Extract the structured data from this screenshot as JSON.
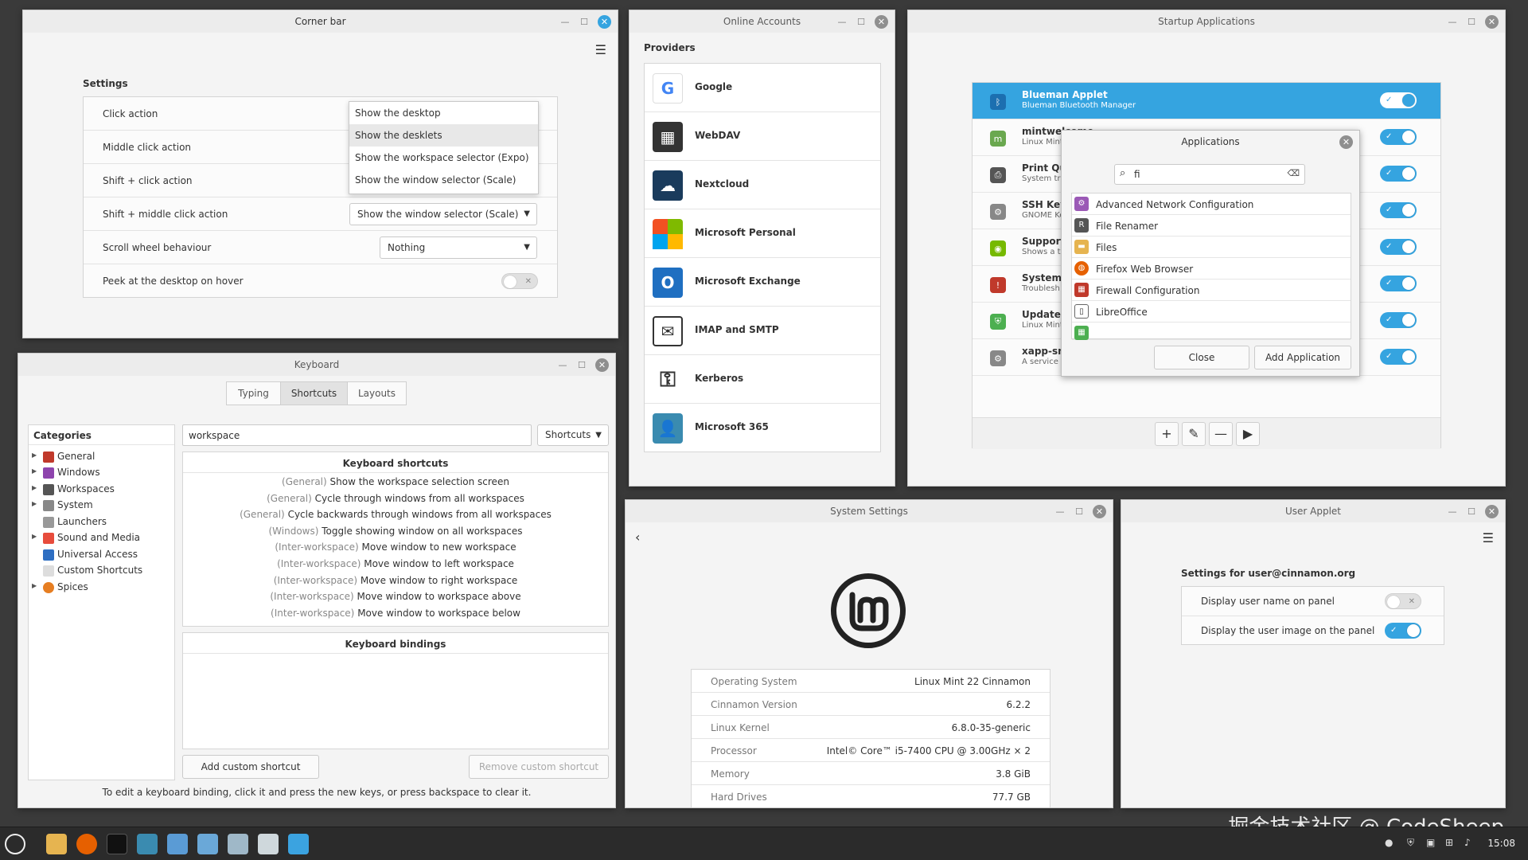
{
  "corner_bar": {
    "title": "Corner bar",
    "settings_heading": "Settings",
    "rows": [
      {
        "label": "Click action"
      },
      {
        "label": "Middle click action"
      },
      {
        "label": "Shift + click action"
      },
      {
        "label": "Shift + middle click action",
        "value": "Show the window selector (Scale)"
      },
      {
        "label": "Scroll wheel behaviour",
        "value": "Nothing"
      },
      {
        "label": "Peek at the desktop on hover",
        "toggle": "off"
      }
    ],
    "dropdown_options": [
      "Show the desktop",
      "Show the desklets",
      "Show the workspace selector (Expo)",
      "Show the window selector (Scale)"
    ],
    "dropdown_selected": "Show the desklets"
  },
  "online_accounts": {
    "title": "Online Accounts",
    "heading": "Providers",
    "providers": [
      "Google",
      "WebDAV",
      "Nextcloud",
      "Microsoft Personal",
      "Microsoft Exchange",
      "IMAP and SMTP",
      "Kerberos",
      "Microsoft 365"
    ]
  },
  "startup_apps": {
    "title": "Startup Applications",
    "items": [
      {
        "name": "Blueman Applet",
        "desc": "Blueman Bluetooth Manager",
        "on": true
      },
      {
        "name": "mintwelcome",
        "desc": "Linux Mint",
        "on": true
      },
      {
        "name": "Print Qu",
        "desc": "System tra",
        "on": true
      },
      {
        "name": "SSH Key",
        "desc": "GNOME Ke",
        "on": true
      },
      {
        "name": "Support",
        "desc": "Shows a tr",
        "on": true
      },
      {
        "name": "System F",
        "desc": "Troublesh",
        "on": true
      },
      {
        "name": "Update M",
        "desc": "Linux Mint",
        "on": true
      },
      {
        "name": "xapp-sn-",
        "desc": "A service t",
        "on": true
      }
    ],
    "tool_add": "+",
    "tool_edit": "✎",
    "tool_remove": "—",
    "tool_run": "▶"
  },
  "applications_dialog": {
    "title": "Applications",
    "search_value": "fi",
    "apps": [
      "Advanced Network Configuration",
      "File Renamer",
      "Files",
      "Firefox Web Browser",
      "Firewall Configuration",
      "LibreOffice"
    ],
    "close_label": "Close",
    "add_label": "Add Application"
  },
  "keyboard": {
    "title": "Keyboard",
    "tabs": [
      "Typing",
      "Shortcuts",
      "Layouts"
    ],
    "active_tab": "Shortcuts",
    "categories_heading": "Categories",
    "categories": [
      "General",
      "Windows",
      "Workspaces",
      "System",
      "Launchers",
      "Sound and Media",
      "Universal Access",
      "Custom Shortcuts",
      "Spices"
    ],
    "search_value": "workspace",
    "filter_label": "Shortcuts",
    "shortcuts_heading": "Keyboard shortcuts",
    "shortcuts": [
      {
        "ctx": "(General)",
        "text": "Show the workspace selection screen"
      },
      {
        "ctx": "(General)",
        "text": "Cycle through windows from all workspaces"
      },
      {
        "ctx": "(General)",
        "text": "Cycle backwards through windows from all workspaces"
      },
      {
        "ctx": "(Windows)",
        "text": "Toggle showing window on all workspaces"
      },
      {
        "ctx": "(Inter-workspace)",
        "text": "Move window to new workspace"
      },
      {
        "ctx": "(Inter-workspace)",
        "text": "Move window to left workspace"
      },
      {
        "ctx": "(Inter-workspace)",
        "text": "Move window to right workspace"
      },
      {
        "ctx": "(Inter-workspace)",
        "text": "Move window to workspace above"
      },
      {
        "ctx": "(Inter-workspace)",
        "text": "Move window to workspace below"
      }
    ],
    "bindings_heading": "Keyboard bindings",
    "add_custom": "Add custom shortcut",
    "remove_custom": "Remove custom shortcut",
    "hint": "To edit a keyboard binding, click it and press the new keys, or press backspace to clear it."
  },
  "system_settings": {
    "title": "System Settings",
    "info": [
      {
        "k": "Operating System",
        "v": "Linux Mint 22 Cinnamon"
      },
      {
        "k": "Cinnamon Version",
        "v": "6.2.2"
      },
      {
        "k": "Linux Kernel",
        "v": "6.8.0-35-generic"
      },
      {
        "k": "Processor",
        "v": "Intel© Core™ i5-7400 CPU @ 3.00GHz × 2"
      },
      {
        "k": "Memory",
        "v": "3.8 GiB"
      },
      {
        "k": "Hard Drives",
        "v": "77.7 GB"
      }
    ]
  },
  "user_applet": {
    "title": "User Applet",
    "heading": "Settings for user@cinnamon.org",
    "rows": [
      {
        "label": "Display user name on panel",
        "on": false
      },
      {
        "label": "Display the user image on the panel",
        "on": true
      }
    ]
  },
  "taskbar": {
    "clock": "15:08",
    "watermark": "掘金技术社区 @ CodeSheep"
  },
  "colors": {
    "accent": "#35a4e0",
    "panel": "#2b2b2b"
  }
}
